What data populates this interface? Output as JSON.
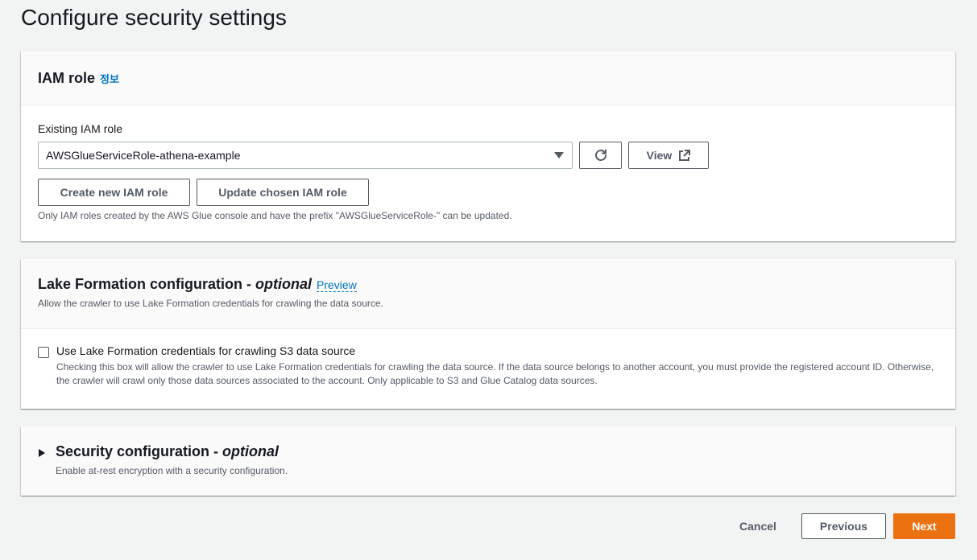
{
  "page": {
    "title": "Configure security settings"
  },
  "iam": {
    "title": "IAM role",
    "info_link": "정보",
    "field_label": "Existing IAM role",
    "selected_role": "AWSGlueServiceRole-athena-example",
    "view_label": "View",
    "create_label": "Create new IAM role",
    "update_label": "Update chosen IAM role",
    "hint": "Only IAM roles created by the AWS Glue console and have the prefix \"AWSGlueServiceRole-\" can be updated."
  },
  "lake_formation": {
    "title": "Lake Formation configuration - ",
    "title_optional": "optional",
    "preview_link": "Preview",
    "description": "Allow the crawler to use Lake Formation credentials for crawling the data source.",
    "checkbox_label": "Use Lake Formation credentials for crawling S3 data source",
    "checkbox_checked": false,
    "checkbox_description": "Checking this box will allow the crawler to use Lake Formation credentials for crawling the data source. If the data source belongs to another account, you must provide the registered account ID. Otherwise, the crawler will crawl only those data sources associated to the account. Only applicable to S3 and Glue Catalog data sources."
  },
  "security_config": {
    "title": "Security configuration - ",
    "title_optional": "optional",
    "description": "Enable at-rest encryption with a security configuration.",
    "expanded": false
  },
  "footer": {
    "cancel_label": "Cancel",
    "previous_label": "Previous",
    "next_label": "Next"
  },
  "colors": {
    "accent": "#ec7211",
    "link": "#0073bb",
    "background": "#f2f3f3"
  }
}
